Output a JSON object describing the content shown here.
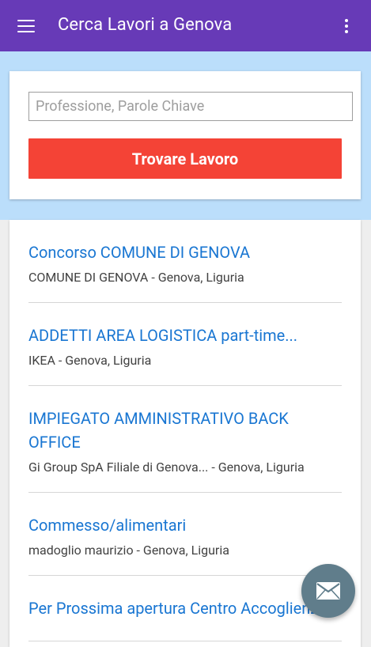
{
  "appbar": {
    "title": "Cerca Lavori a Genova",
    "menu_icon": "hamburger-menu-icon",
    "overflow_icon": "more-vertical-icon",
    "color": "#673ab7"
  },
  "search": {
    "placeholder": "Professione, Parole Chiave",
    "value": "",
    "button_label": "Trovare Lavoro",
    "button_color": "#f44336"
  },
  "jobs": [
    {
      "title": "Concorso COMUNE DI GENOVA",
      "meta": "COMUNE DI GENOVA - Genova, Liguria"
    },
    {
      "title": "ADDETTI AREA LOGISTICA part-time...",
      "meta": "IKEA - Genova, Liguria"
    },
    {
      "title": "IMPIEGATO AMMINISTRATIVO BACK OFFICE",
      "meta": "Gi Group SpA Filiale di Genova... - Genova, Liguria"
    },
    {
      "title": "Commesso/alimentari",
      "meta": "madoglio maurizio - Genova, Liguria"
    },
    {
      "title": "Per Prossima apertura Centro Accoglienza",
      "meta": ""
    }
  ],
  "fab": {
    "icon": "envelope-icon",
    "color": "#607d8b"
  },
  "colors": {
    "band": "#bbdefb",
    "link": "#1976d2"
  }
}
